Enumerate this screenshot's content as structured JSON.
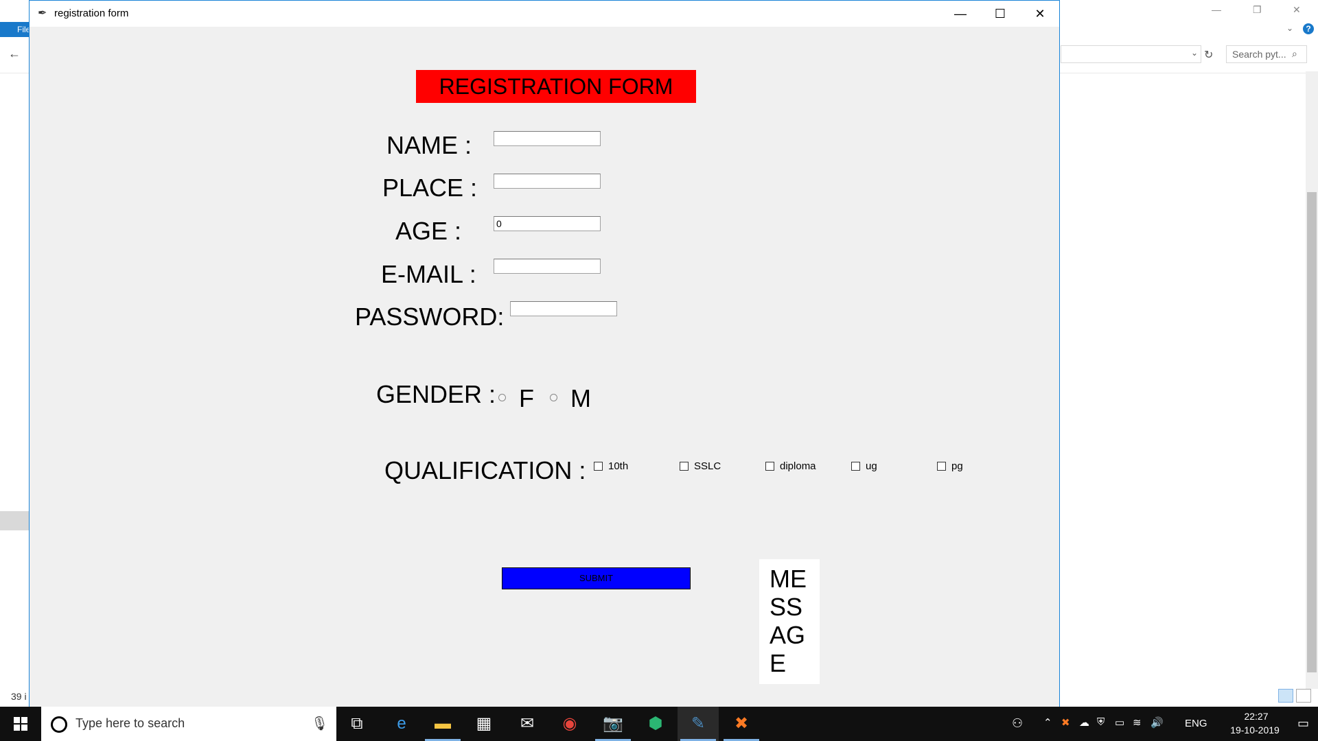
{
  "background_explorer": {
    "file_tab": "File",
    "search_placeholder": "Search pyt...",
    "item_count": "39 i"
  },
  "window": {
    "title": "registration form",
    "controls": {
      "minimize": "—",
      "maximize": "☐",
      "close": "✕"
    }
  },
  "form": {
    "title": "REGISTRATION FORM",
    "title_bg": "#ff0000",
    "fields": {
      "name": {
        "label": "NAME :",
        "value": ""
      },
      "place": {
        "label": "PLACE :",
        "value": ""
      },
      "age": {
        "label": "AGE :",
        "value": "0"
      },
      "email": {
        "label": "E-MAIL :",
        "value": ""
      },
      "password": {
        "label": "PASSWORD:",
        "value": ""
      }
    },
    "gender": {
      "label": "GENDER :",
      "options": [
        "F",
        "M"
      ]
    },
    "qualification": {
      "label": "QUALIFICATION :",
      "options": [
        "10th",
        "SSLC",
        "diploma",
        "ug",
        "pg"
      ]
    },
    "submit": {
      "label": "SUBMIT",
      "bg": "#0000ff"
    },
    "message": "MESSAGE"
  },
  "taskbar": {
    "search_placeholder": "Type here to search",
    "language": "ENG",
    "time": "22:27",
    "date": "19-10-2019",
    "apps": [
      "task-view-icon",
      "edge-icon",
      "file-explorer-icon",
      "store-icon",
      "mail-icon",
      "chrome-icon",
      "camera-icon",
      "app-icon",
      "python-icon",
      "xampp-icon"
    ]
  }
}
